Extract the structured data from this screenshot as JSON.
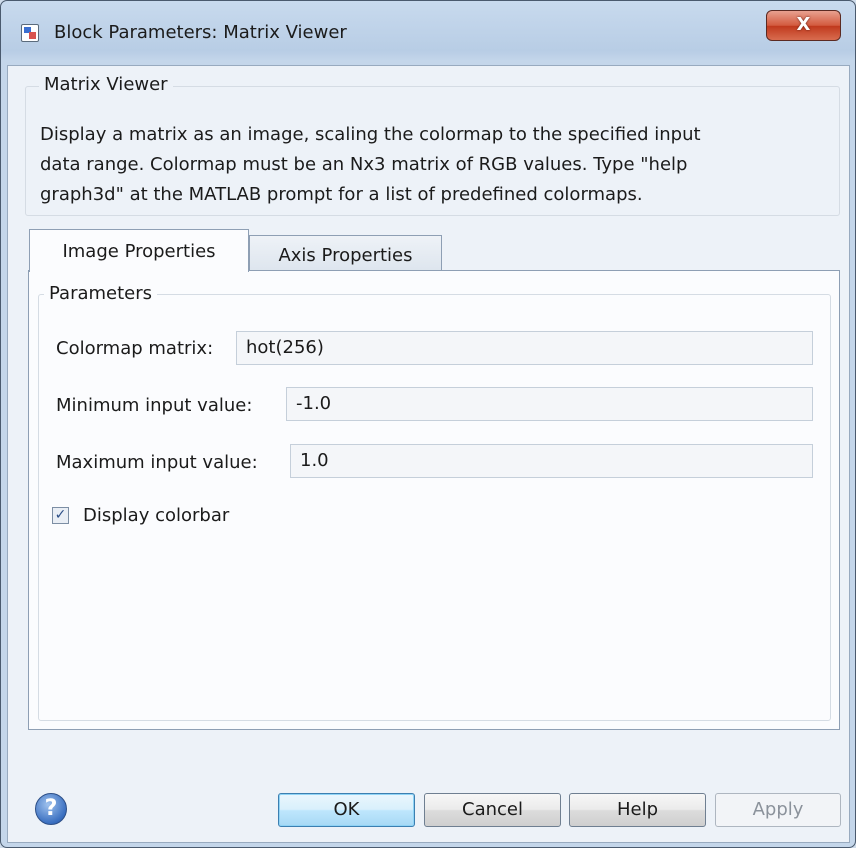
{
  "window": {
    "title": "Block Parameters: Matrix Viewer",
    "close_glyph": "X"
  },
  "header_group": {
    "legend": "Matrix Viewer",
    "description_lines": [
      "Display a matrix as an image, scaling the colormap to the specified input",
      "data range.  Colormap must be an Nx3 matrix of RGB values.  Type \"help",
      "graph3d\" at the MATLAB prompt for a list of predefined colormaps."
    ]
  },
  "tabs": [
    {
      "label": "Image Properties",
      "active": true
    },
    {
      "label": "Axis Properties",
      "active": false
    }
  ],
  "parameters": {
    "legend": "Parameters",
    "colormap_label": "Colormap matrix:",
    "colormap_value": "hot(256)",
    "min_label": "Minimum input value:",
    "min_value": "-1.0",
    "max_label": "Maximum input value:",
    "max_value": "1.0",
    "colorbar_label": "Display colorbar",
    "colorbar_checked": true,
    "check_glyph": "✓"
  },
  "buttons": {
    "help_glyph": "?",
    "ok": "OK",
    "cancel": "Cancel",
    "help": "Help",
    "apply": "Apply"
  }
}
